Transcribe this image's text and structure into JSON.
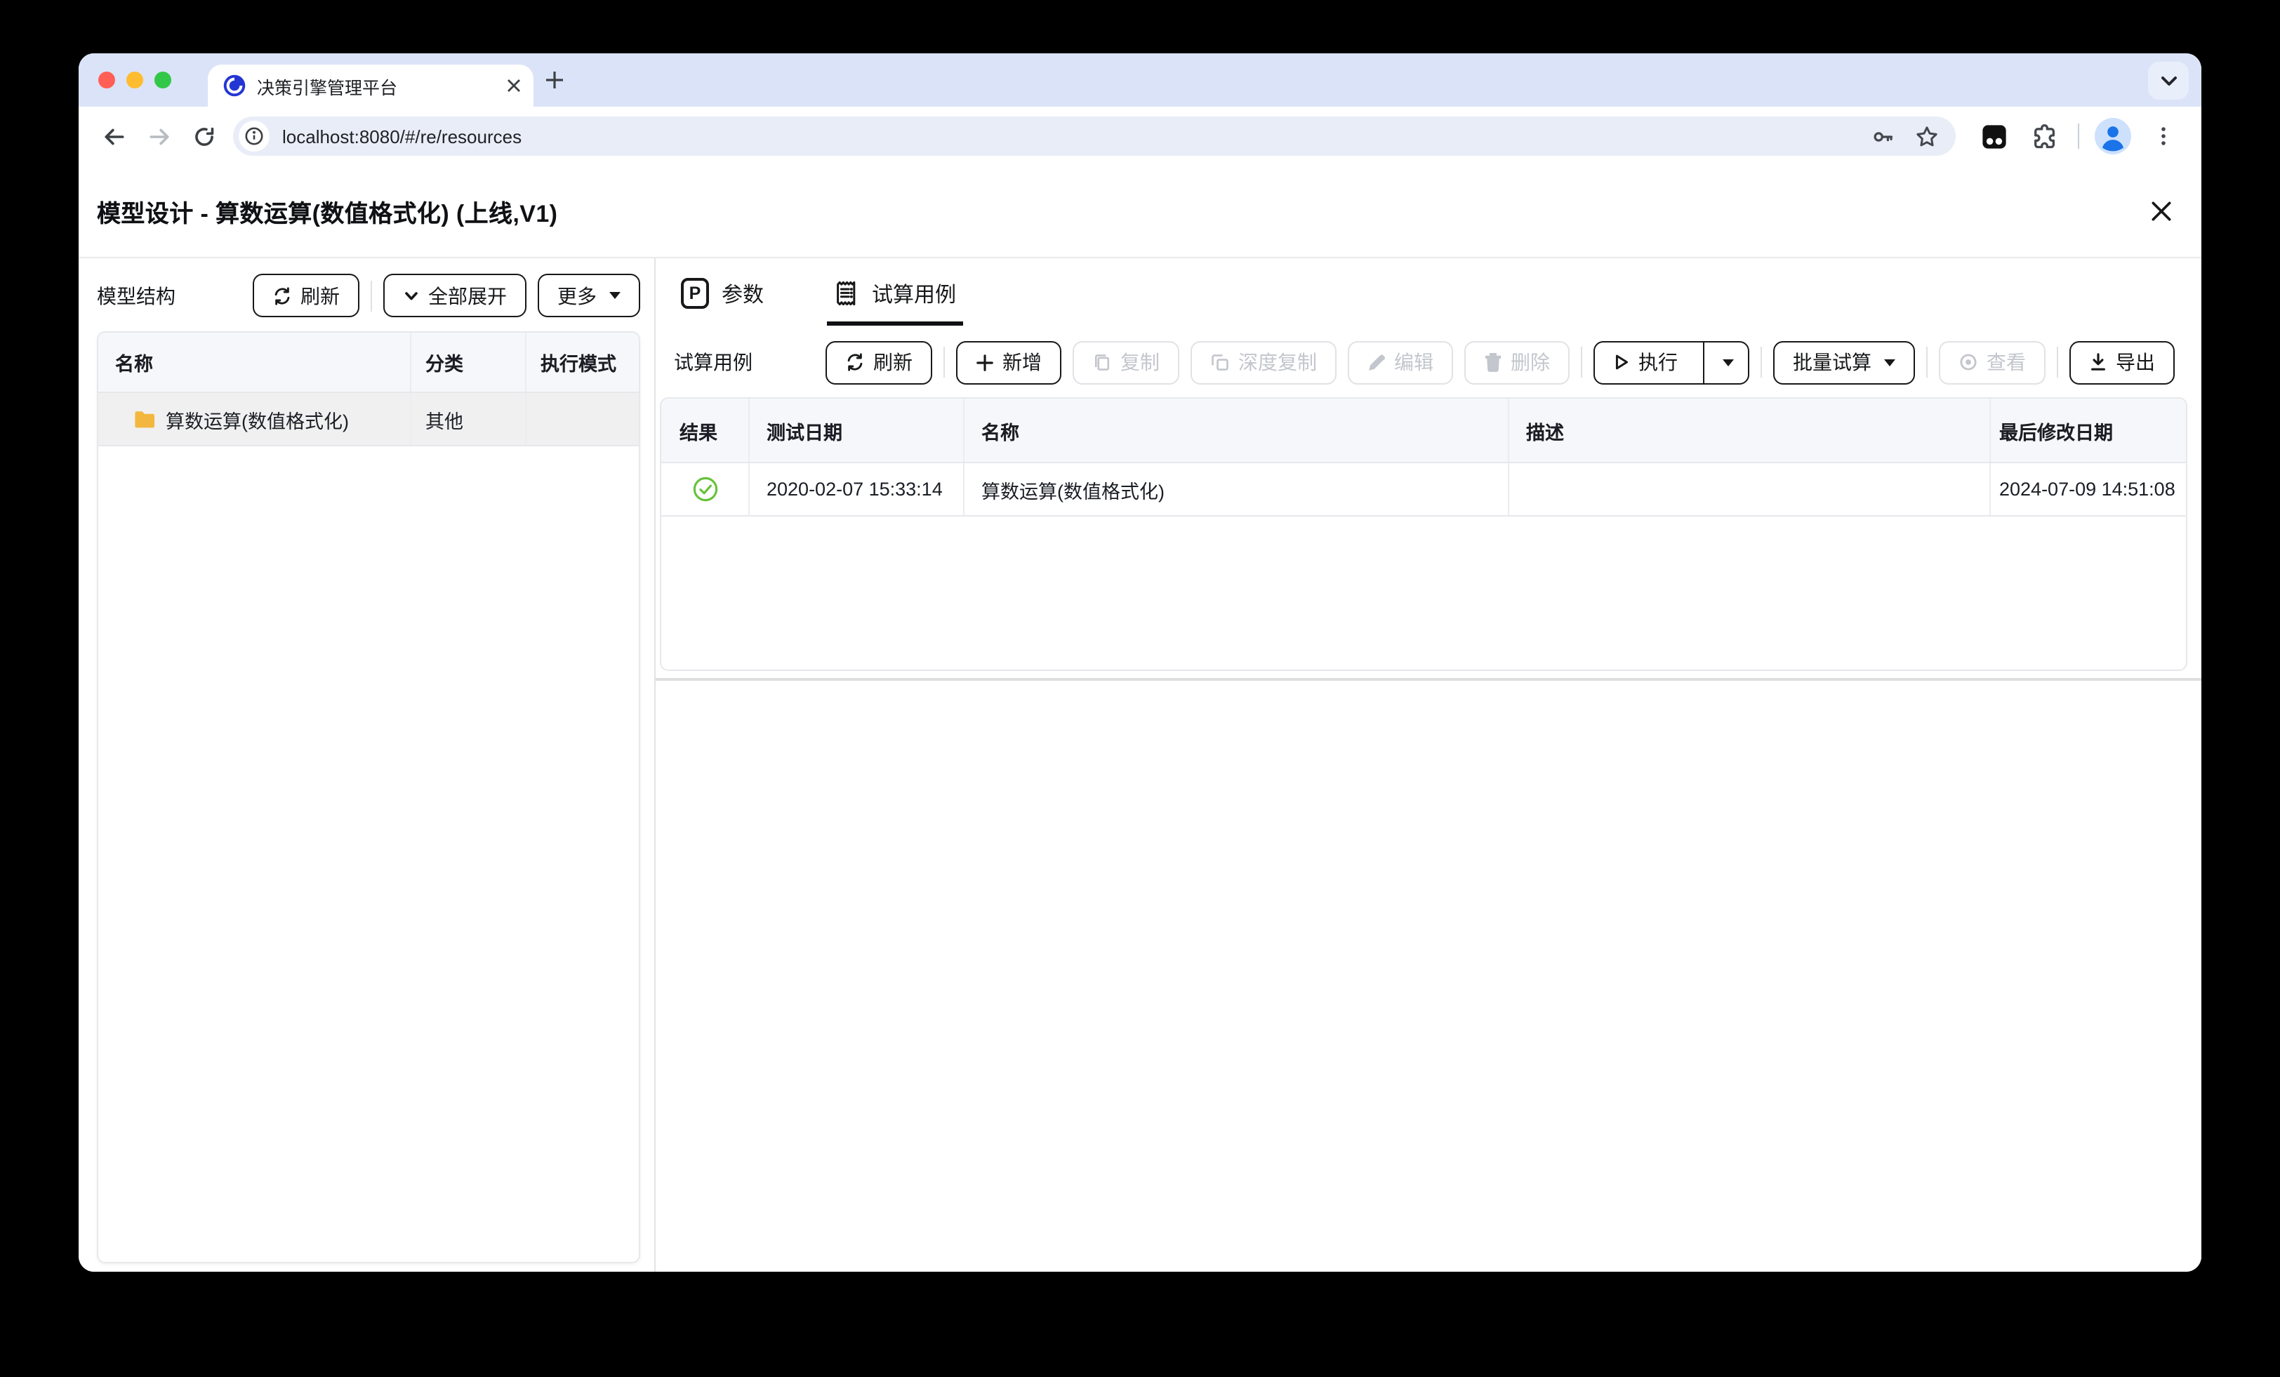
{
  "browser": {
    "tab_title": "决策引擎管理平台",
    "url": "localhost:8080/#/re/resources"
  },
  "page": {
    "title": "模型设计 - 算数运算(数值格式化) (上线,V1)"
  },
  "model_tree": {
    "title": "模型结构",
    "buttons": {
      "refresh": "刷新",
      "expand_all": "全部展开",
      "more": "更多"
    },
    "columns": {
      "name": "名称",
      "category": "分类",
      "exec_mode": "执行模式"
    },
    "rows": [
      {
        "name": "算数运算(数值格式化)",
        "category": "其他",
        "exec_mode": ""
      }
    ]
  },
  "workspace": {
    "tabs": {
      "params": "参数",
      "test_cases": "试算用例"
    },
    "param_icon_letter": "P",
    "section_title": "试算用例",
    "toolbar": {
      "refresh": "刷新",
      "add": "新增",
      "copy": "复制",
      "deep_copy": "深度复制",
      "edit": "编辑",
      "delete": "删除",
      "run": "执行",
      "batch_run": "批量试算",
      "view": "查看",
      "export": "导出"
    },
    "columns": {
      "result": "结果",
      "test_date": "测试日期",
      "name": "名称",
      "description": "描述",
      "last_modified": "最后修改日期"
    },
    "rows": [
      {
        "result": "success",
        "test_date": "2020-02-07 15:33:14",
        "name": "算数运算(数值格式化)",
        "description": "",
        "last_modified": "2024-07-09 14:51:08"
      }
    ]
  },
  "colors": {
    "success_green": "#67c23a",
    "folder_yellow": "#f3b73f",
    "tab_strip": "#dbe3f8",
    "accent_blue": "#1a73e8",
    "selected_row_gray": "#f0f0f0"
  }
}
